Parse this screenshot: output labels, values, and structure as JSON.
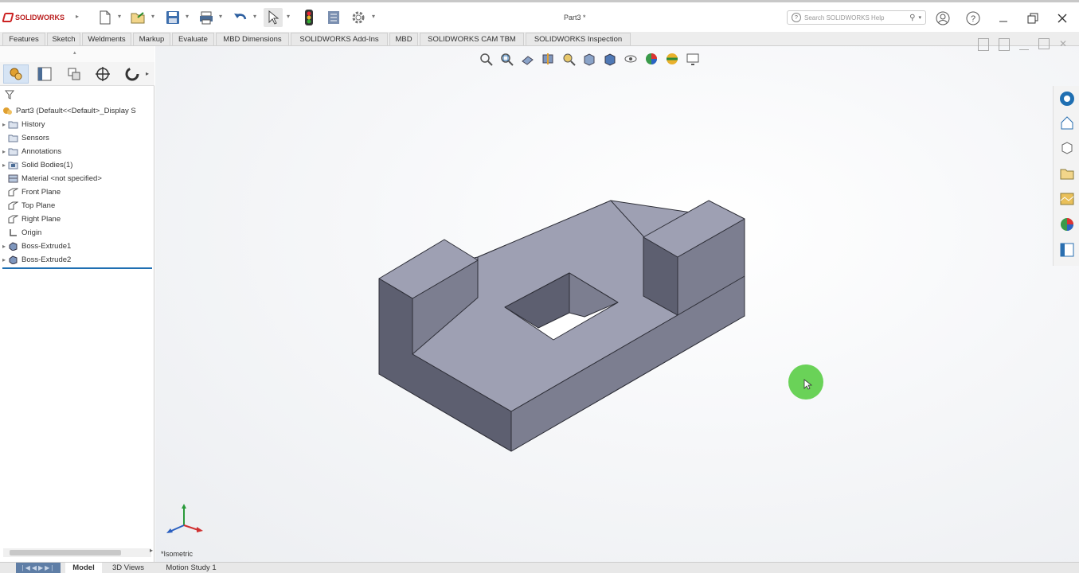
{
  "app": {
    "logo_text": "SOLIDWORKS",
    "document_title": "Part3 *"
  },
  "help_search": {
    "placeholder": "Search SOLIDWORKS Help"
  },
  "command_tabs": [
    "Features",
    "Sketch",
    "Weldments",
    "Markup",
    "Evaluate",
    "MBD Dimensions",
    "SOLIDWORKS Add-Ins",
    "MBD",
    "SOLIDWORKS CAM TBM",
    "SOLIDWORKS Inspection"
  ],
  "feature_tree": {
    "root": "Part3  (Default<<Default>_Display S",
    "items": [
      {
        "label": "History",
        "icon": "history-folder-icon",
        "expandable": true
      },
      {
        "label": "Sensors",
        "icon": "sensors-folder-icon",
        "expandable": false
      },
      {
        "label": "Annotations",
        "icon": "annotations-folder-icon",
        "expandable": true
      },
      {
        "label": "Solid Bodies(1)",
        "icon": "solid-bodies-folder-icon",
        "expandable": true
      },
      {
        "label": "Material <not specified>",
        "icon": "material-icon",
        "expandable": false
      },
      {
        "label": "Front Plane",
        "icon": "plane-icon",
        "expandable": false
      },
      {
        "label": "Top Plane",
        "icon": "plane-icon",
        "expandable": false
      },
      {
        "label": "Right Plane",
        "icon": "plane-icon",
        "expandable": false
      },
      {
        "label": "Origin",
        "icon": "origin-icon",
        "expandable": false
      },
      {
        "label": "Boss-Extrude1",
        "icon": "boss-extrude-icon",
        "expandable": true
      },
      {
        "label": "Boss-Extrude2",
        "icon": "boss-extrude-icon",
        "expandable": true
      }
    ]
  },
  "status_left": "*Isometric",
  "bottom_tabs": [
    "Model",
    "3D Views",
    "Motion Study 1"
  ],
  "colors": {
    "accent": "#1f6fb2",
    "model_face_top": "#9ea0b3",
    "model_face_left": "#5d5f70",
    "model_face_right": "#7c7e90",
    "cursor_highlight": "#5acd46"
  }
}
